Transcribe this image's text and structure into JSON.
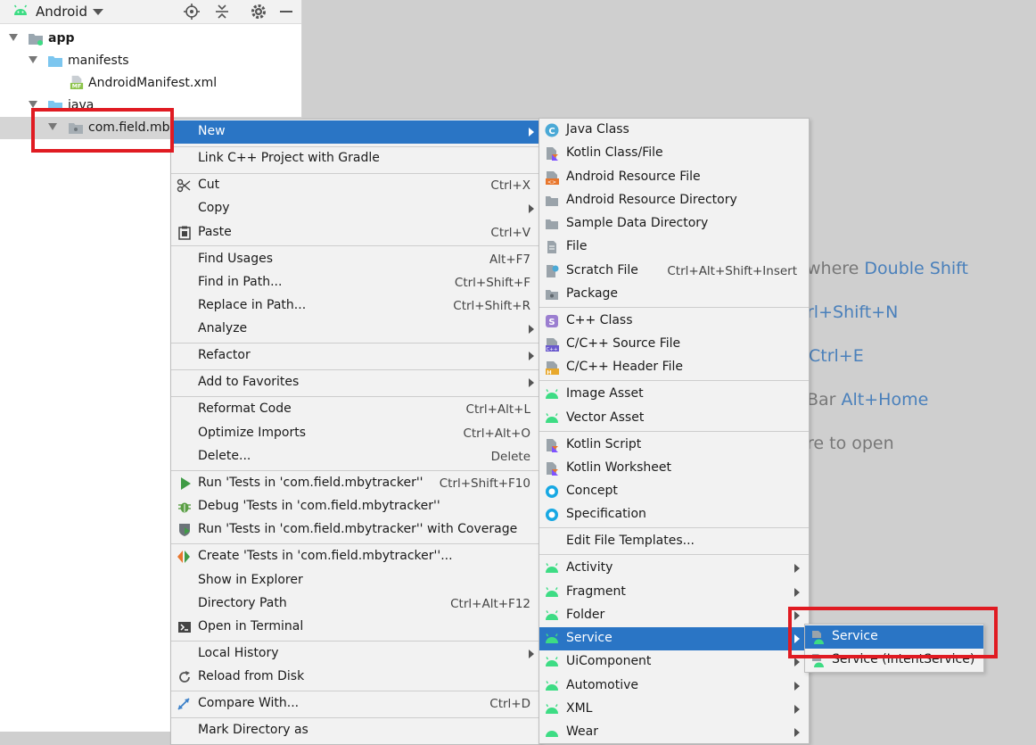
{
  "project_panel": {
    "view_selector": "Android",
    "tree": [
      {
        "label": "app"
      },
      {
        "label": "manifests"
      },
      {
        "label": "AndroidManifest.xml",
        "badge": "MF"
      },
      {
        "label": "java"
      },
      {
        "label": "com.field.mby"
      }
    ]
  },
  "hints": [
    {
      "text": "where ",
      "key": "Double Shift"
    },
    {
      "text": "",
      "key": "rl+Shift+N"
    },
    {
      "text": "",
      "key": "Ctrl+E"
    },
    {
      "text": "Bar ",
      "key": "Alt+Home"
    },
    {
      "text": "re to open",
      "key": ""
    }
  ],
  "context_menu": {
    "items": [
      {
        "label": "New",
        "submenu": true
      },
      {
        "label": "Link C++ Project with Gradle"
      },
      {
        "label": "Cut",
        "shortcut": "Ctrl+X"
      },
      {
        "label": "Copy",
        "submenu": true
      },
      {
        "label": "Paste",
        "shortcut": "Ctrl+V"
      },
      {
        "label": "Find Usages",
        "shortcut": "Alt+F7"
      },
      {
        "label": "Find in Path...",
        "shortcut": "Ctrl+Shift+F"
      },
      {
        "label": "Replace in Path...",
        "shortcut": "Ctrl+Shift+R"
      },
      {
        "label": "Analyze",
        "submenu": true
      },
      {
        "label": "Refactor",
        "submenu": true
      },
      {
        "label": "Add to Favorites",
        "submenu": true
      },
      {
        "label": "Reformat Code",
        "shortcut": "Ctrl+Alt+L"
      },
      {
        "label": "Optimize Imports",
        "shortcut": "Ctrl+Alt+O"
      },
      {
        "label": "Delete...",
        "shortcut": "Delete"
      },
      {
        "label": "Run 'Tests in 'com.field.mbytracker''",
        "shortcut": "Ctrl+Shift+F10"
      },
      {
        "label": "Debug 'Tests in 'com.field.mbytracker''"
      },
      {
        "label": "Run 'Tests in 'com.field.mbytracker'' with Coverage"
      },
      {
        "label": "Create 'Tests in 'com.field.mbytracker''..."
      },
      {
        "label": "Show in Explorer"
      },
      {
        "label": "Directory Path",
        "shortcut": "Ctrl+Alt+F12"
      },
      {
        "label": "Open in Terminal"
      },
      {
        "label": "Local History",
        "submenu": true
      },
      {
        "label": "Reload from Disk"
      },
      {
        "label": "Compare With...",
        "shortcut": "Ctrl+D"
      },
      {
        "label": "Mark Directory as"
      }
    ]
  },
  "new_submenu": {
    "items": [
      {
        "label": "Java Class"
      },
      {
        "label": "Kotlin Class/File"
      },
      {
        "label": "Android Resource File"
      },
      {
        "label": "Android Resource Directory"
      },
      {
        "label": "Sample Data Directory"
      },
      {
        "label": "File"
      },
      {
        "label": "Scratch File",
        "shortcut": "Ctrl+Alt+Shift+Insert"
      },
      {
        "label": "Package"
      },
      {
        "label": "C++ Class"
      },
      {
        "label": "C/C++ Source File"
      },
      {
        "label": "C/C++ Header File"
      },
      {
        "label": "Image Asset"
      },
      {
        "label": "Vector Asset"
      },
      {
        "label": "Kotlin Script"
      },
      {
        "label": "Kotlin Worksheet"
      },
      {
        "label": "Concept"
      },
      {
        "label": "Specification"
      },
      {
        "label": "Edit File Templates..."
      },
      {
        "label": "Activity",
        "submenu": true
      },
      {
        "label": "Fragment",
        "submenu": true
      },
      {
        "label": "Folder",
        "submenu": true
      },
      {
        "label": "Service",
        "submenu": true
      },
      {
        "label": "UiComponent",
        "submenu": true
      },
      {
        "label": "Automotive",
        "submenu": true
      },
      {
        "label": "XML",
        "submenu": true
      },
      {
        "label": "Wear",
        "submenu": true
      }
    ]
  },
  "service_submenu": {
    "items": [
      {
        "label": "Service"
      },
      {
        "label": "Service (IntentService)"
      }
    ]
  },
  "colors": {
    "highlight": "#2a75c5",
    "annotation_red": "#e01b22",
    "android_green": "#3ddc84"
  }
}
